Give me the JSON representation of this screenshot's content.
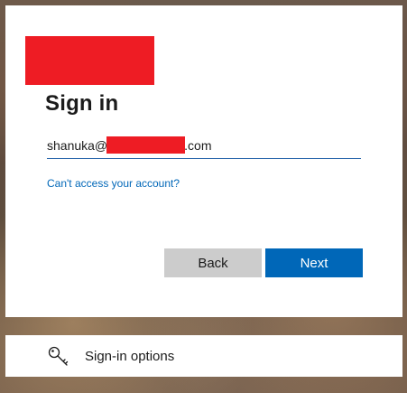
{
  "signin": {
    "title": "Sign in",
    "email": {
      "prefix": "shanuka@",
      "suffix": ".com"
    },
    "cant_access_link": "Can't access your account?",
    "back_label": "Back",
    "next_label": "Next"
  },
  "options": {
    "label": "Sign-in options",
    "icon": "key-icon"
  },
  "colors": {
    "accent": "#0067b8",
    "back_button": "#cccccc",
    "redaction": "#ee1c24"
  }
}
